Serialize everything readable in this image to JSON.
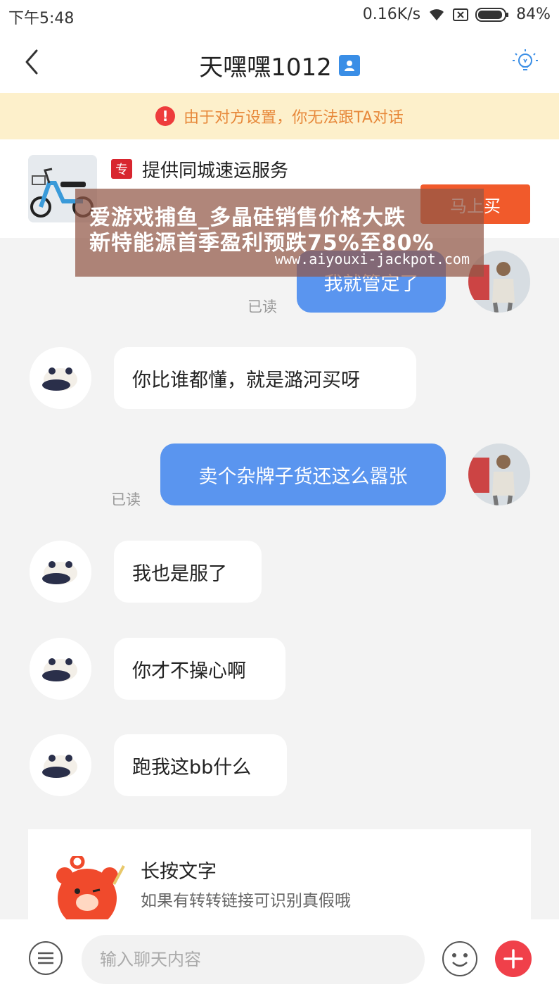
{
  "status": {
    "time": "下午5:48",
    "network_speed": "0.16K/s",
    "battery": "84%"
  },
  "nav": {
    "title": "天嘿嘿1012"
  },
  "warning": {
    "text": "由于对方设置，你无法跟TA对话"
  },
  "product": {
    "tag": "专",
    "title": "提供同城速运服务",
    "buy_label": "马上买"
  },
  "watermark": {
    "line1": "爱游戏捕鱼_多晶硅销售价格大跌",
    "line2": "新特能源首季盈利预跌75%至80%",
    "url": "www.aiyouxi-jackpot.com"
  },
  "messages": [
    {
      "side": "right",
      "text": "我就管定了",
      "status": "已读"
    },
    {
      "side": "left",
      "text": "你比谁都懂，就是潞河买呀"
    },
    {
      "side": "right",
      "text": "卖个杂牌子货还这么嚣张",
      "status": "已读"
    },
    {
      "side": "left",
      "text": "我也是服了"
    },
    {
      "side": "left",
      "text": "你才不操心啊"
    },
    {
      "side": "left",
      "text": "跑我这bb什么"
    }
  ],
  "tip": {
    "title": "长按文字",
    "subtitle": "如果有转转链接可识别真假哦"
  },
  "input": {
    "placeholder": "输入聊天内容"
  },
  "colors": {
    "accent_blue": "#5a95ef",
    "warning_bg": "#fdf0cb",
    "warning_text": "#e7883a",
    "buy_button": "#f15a2b",
    "plus_button": "#f0404a"
  }
}
